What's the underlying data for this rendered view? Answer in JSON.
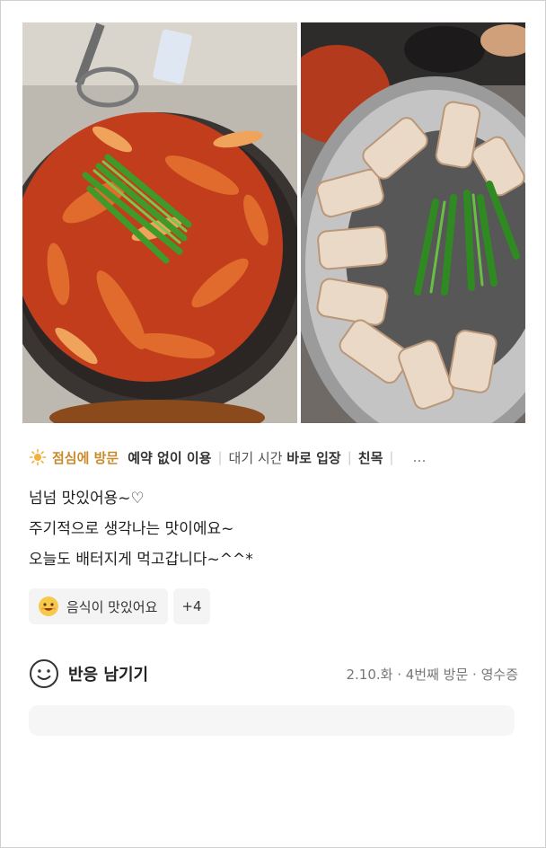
{
  "visit": {
    "highlight": "점심에 방문",
    "tags": [
      {
        "label": "",
        "value": "예약 없이 이용"
      },
      {
        "label": "대기 시간",
        "value": "바로 입장"
      },
      {
        "label": "",
        "value": "친목"
      }
    ],
    "more": "…"
  },
  "review": {
    "lines": [
      "넘넘 맛있어용~♡",
      "주기적으로 생각나는 맛이에요~",
      "오늘도 배터지게 먹고갑니다~^^*"
    ]
  },
  "keywords": {
    "main": "음식이 맛있어요",
    "extra": "+4"
  },
  "reaction": {
    "label": "반응 남기기"
  },
  "meta": {
    "date": "2.10.화",
    "visit_count": "4번째 방문",
    "receipt": "영수증"
  },
  "colors": {
    "highlight": "#c98a2b",
    "chip_bg": "#f4f4f4"
  },
  "icons": {
    "time_of_day": "sun-icon",
    "keyword": "smiling-face-emoji",
    "reaction": "smiley-outline-icon"
  }
}
